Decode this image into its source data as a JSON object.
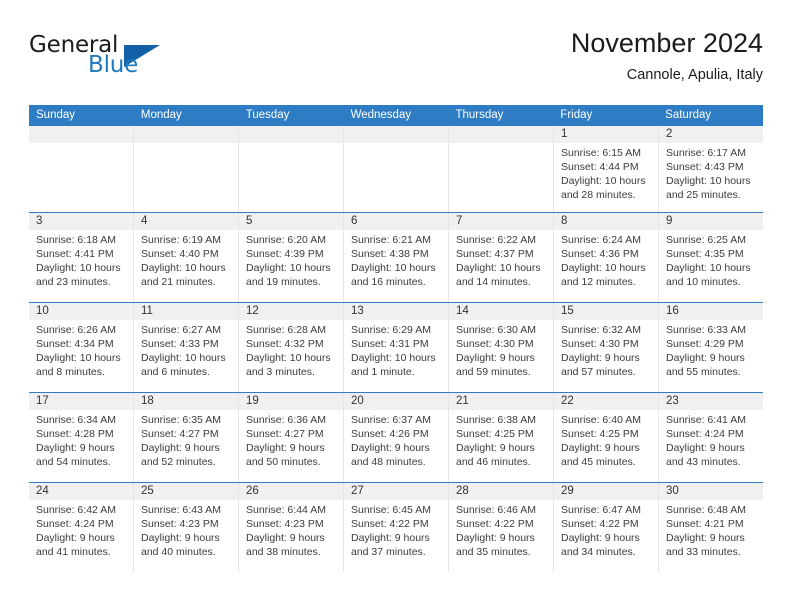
{
  "logo": {
    "word1": "General",
    "word2": "Blue",
    "triangle_color": "#1460a8",
    "blue_color": "#1f77be"
  },
  "header": {
    "title": "November 2024",
    "subtitle": "Cannole, Apulia, Italy"
  },
  "theme": {
    "header_blue": "#2e7cc3",
    "daynum_bg": "#f0f0f0",
    "cell_border": "#e6e6e6"
  },
  "weekdays": [
    "Sunday",
    "Monday",
    "Tuesday",
    "Wednesday",
    "Thursday",
    "Friday",
    "Saturday"
  ],
  "weeks": [
    [
      {
        "day": "",
        "empty": true
      },
      {
        "day": "",
        "empty": true
      },
      {
        "day": "",
        "empty": true
      },
      {
        "day": "",
        "empty": true
      },
      {
        "day": "",
        "empty": true
      },
      {
        "day": "1",
        "sunrise": "Sunrise: 6:15 AM",
        "sunset": "Sunset: 4:44 PM",
        "daylight1": "Daylight: 10 hours",
        "daylight2": "and 28 minutes."
      },
      {
        "day": "2",
        "sunrise": "Sunrise: 6:17 AM",
        "sunset": "Sunset: 4:43 PM",
        "daylight1": "Daylight: 10 hours",
        "daylight2": "and 25 minutes."
      }
    ],
    [
      {
        "day": "3",
        "sunrise": "Sunrise: 6:18 AM",
        "sunset": "Sunset: 4:41 PM",
        "daylight1": "Daylight: 10 hours",
        "daylight2": "and 23 minutes."
      },
      {
        "day": "4",
        "sunrise": "Sunrise: 6:19 AM",
        "sunset": "Sunset: 4:40 PM",
        "daylight1": "Daylight: 10 hours",
        "daylight2": "and 21 minutes."
      },
      {
        "day": "5",
        "sunrise": "Sunrise: 6:20 AM",
        "sunset": "Sunset: 4:39 PM",
        "daylight1": "Daylight: 10 hours",
        "daylight2": "and 19 minutes."
      },
      {
        "day": "6",
        "sunrise": "Sunrise: 6:21 AM",
        "sunset": "Sunset: 4:38 PM",
        "daylight1": "Daylight: 10 hours",
        "daylight2": "and 16 minutes."
      },
      {
        "day": "7",
        "sunrise": "Sunrise: 6:22 AM",
        "sunset": "Sunset: 4:37 PM",
        "daylight1": "Daylight: 10 hours",
        "daylight2": "and 14 minutes."
      },
      {
        "day": "8",
        "sunrise": "Sunrise: 6:24 AM",
        "sunset": "Sunset: 4:36 PM",
        "daylight1": "Daylight: 10 hours",
        "daylight2": "and 12 minutes."
      },
      {
        "day": "9",
        "sunrise": "Sunrise: 6:25 AM",
        "sunset": "Sunset: 4:35 PM",
        "daylight1": "Daylight: 10 hours",
        "daylight2": "and 10 minutes."
      }
    ],
    [
      {
        "day": "10",
        "sunrise": "Sunrise: 6:26 AM",
        "sunset": "Sunset: 4:34 PM",
        "daylight1": "Daylight: 10 hours",
        "daylight2": "and 8 minutes."
      },
      {
        "day": "11",
        "sunrise": "Sunrise: 6:27 AM",
        "sunset": "Sunset: 4:33 PM",
        "daylight1": "Daylight: 10 hours",
        "daylight2": "and 6 minutes."
      },
      {
        "day": "12",
        "sunrise": "Sunrise: 6:28 AM",
        "sunset": "Sunset: 4:32 PM",
        "daylight1": "Daylight: 10 hours",
        "daylight2": "and 3 minutes."
      },
      {
        "day": "13",
        "sunrise": "Sunrise: 6:29 AM",
        "sunset": "Sunset: 4:31 PM",
        "daylight1": "Daylight: 10 hours",
        "daylight2": "and 1 minute."
      },
      {
        "day": "14",
        "sunrise": "Sunrise: 6:30 AM",
        "sunset": "Sunset: 4:30 PM",
        "daylight1": "Daylight: 9 hours",
        "daylight2": "and 59 minutes."
      },
      {
        "day": "15",
        "sunrise": "Sunrise: 6:32 AM",
        "sunset": "Sunset: 4:30 PM",
        "daylight1": "Daylight: 9 hours",
        "daylight2": "and 57 minutes."
      },
      {
        "day": "16",
        "sunrise": "Sunrise: 6:33 AM",
        "sunset": "Sunset: 4:29 PM",
        "daylight1": "Daylight: 9 hours",
        "daylight2": "and 55 minutes."
      }
    ],
    [
      {
        "day": "17",
        "sunrise": "Sunrise: 6:34 AM",
        "sunset": "Sunset: 4:28 PM",
        "daylight1": "Daylight: 9 hours",
        "daylight2": "and 54 minutes."
      },
      {
        "day": "18",
        "sunrise": "Sunrise: 6:35 AM",
        "sunset": "Sunset: 4:27 PM",
        "daylight1": "Daylight: 9 hours",
        "daylight2": "and 52 minutes."
      },
      {
        "day": "19",
        "sunrise": "Sunrise: 6:36 AM",
        "sunset": "Sunset: 4:27 PM",
        "daylight1": "Daylight: 9 hours",
        "daylight2": "and 50 minutes."
      },
      {
        "day": "20",
        "sunrise": "Sunrise: 6:37 AM",
        "sunset": "Sunset: 4:26 PM",
        "daylight1": "Daylight: 9 hours",
        "daylight2": "and 48 minutes."
      },
      {
        "day": "21",
        "sunrise": "Sunrise: 6:38 AM",
        "sunset": "Sunset: 4:25 PM",
        "daylight1": "Daylight: 9 hours",
        "daylight2": "and 46 minutes."
      },
      {
        "day": "22",
        "sunrise": "Sunrise: 6:40 AM",
        "sunset": "Sunset: 4:25 PM",
        "daylight1": "Daylight: 9 hours",
        "daylight2": "and 45 minutes."
      },
      {
        "day": "23",
        "sunrise": "Sunrise: 6:41 AM",
        "sunset": "Sunset: 4:24 PM",
        "daylight1": "Daylight: 9 hours",
        "daylight2": "and 43 minutes."
      }
    ],
    [
      {
        "day": "24",
        "sunrise": "Sunrise: 6:42 AM",
        "sunset": "Sunset: 4:24 PM",
        "daylight1": "Daylight: 9 hours",
        "daylight2": "and 41 minutes."
      },
      {
        "day": "25",
        "sunrise": "Sunrise: 6:43 AM",
        "sunset": "Sunset: 4:23 PM",
        "daylight1": "Daylight: 9 hours",
        "daylight2": "and 40 minutes."
      },
      {
        "day": "26",
        "sunrise": "Sunrise: 6:44 AM",
        "sunset": "Sunset: 4:23 PM",
        "daylight1": "Daylight: 9 hours",
        "daylight2": "and 38 minutes."
      },
      {
        "day": "27",
        "sunrise": "Sunrise: 6:45 AM",
        "sunset": "Sunset: 4:22 PM",
        "daylight1": "Daylight: 9 hours",
        "daylight2": "and 37 minutes."
      },
      {
        "day": "28",
        "sunrise": "Sunrise: 6:46 AM",
        "sunset": "Sunset: 4:22 PM",
        "daylight1": "Daylight: 9 hours",
        "daylight2": "and 35 minutes."
      },
      {
        "day": "29",
        "sunrise": "Sunrise: 6:47 AM",
        "sunset": "Sunset: 4:22 PM",
        "daylight1": "Daylight: 9 hours",
        "daylight2": "and 34 minutes."
      },
      {
        "day": "30",
        "sunrise": "Sunrise: 6:48 AM",
        "sunset": "Sunset: 4:21 PM",
        "daylight1": "Daylight: 9 hours",
        "daylight2": "and 33 minutes."
      }
    ]
  ]
}
